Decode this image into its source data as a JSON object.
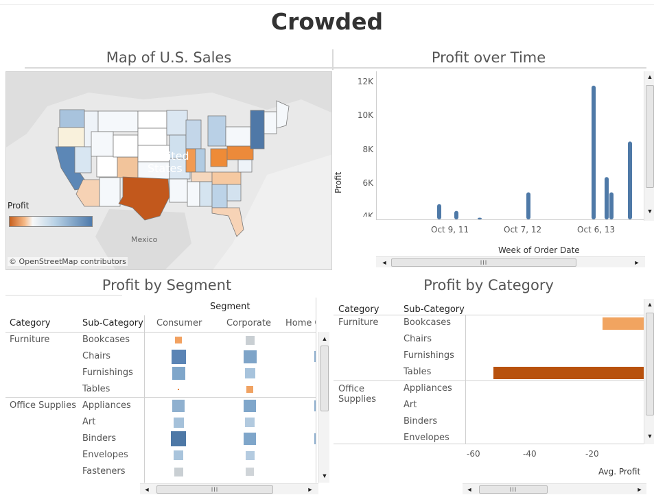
{
  "dashboard": {
    "title": "Crowded"
  },
  "panes": {
    "map": {
      "title": "Map of U.S. Sales"
    },
    "time": {
      "title": "Profit over Time"
    },
    "segment": {
      "title": "Profit by Segment"
    },
    "category": {
      "title": "Profit by Category"
    }
  },
  "map": {
    "country_label": "United\nStates",
    "country_label_line1": "United",
    "country_label_line2": "States",
    "mexico_label": "Mexico",
    "legend_title": "Profit",
    "attribution": "© OpenStreetMap contributors",
    "colors": {
      "negative": "#c8601d",
      "neutral": "#f8f8f8",
      "positive": "#4e7aab",
      "land": "#e5e5e5"
    }
  },
  "chart_data": [
    {
      "type": "bar",
      "title": "Profit over Time",
      "xlabel": "Week of Order Date",
      "ylabel": "Profit",
      "x_ticks": [
        "Oct 9, 11",
        "Oct 7, 12",
        "Oct 6, 13"
      ],
      "y_ticks": [
        "4K",
        "6K",
        "8K",
        "10K",
        "12K"
      ],
      "ylim": [
        4000,
        12500
      ],
      "x": [
        "~Sep 2011",
        "~Oct 2011",
        "~Dec 2011",
        "~Sep 2012",
        "~Sep 2013",
        "~Nov 2013",
        "~Dec 2013",
        "~Feb 2014",
        "~Dec 2014"
      ],
      "values": [
        4900,
        4500,
        4100,
        5600,
        4000,
        11900,
        6500,
        5600,
        8600
      ],
      "series": [
        {
          "values": [
            4900,
            4500,
            4100,
            5600,
            4000,
            11900,
            6500,
            5600,
            8600
          ]
        }
      ],
      "color": "#4e79a7",
      "grid": false
    },
    {
      "type": "heatmap",
      "title": "Profit by Segment",
      "column_header": "Segment",
      "row_headers": [
        "Category",
        "Sub-Category"
      ],
      "columns": [
        "Consumer",
        "Corporate",
        "Home O"
      ],
      "rows": [
        {
          "category": "Furniture",
          "sub": "Bookcases",
          "consumer": {
            "size": 0.45,
            "color": "#f2a160"
          },
          "corporate": {
            "size": 0.6,
            "color": "#c9cfd3"
          }
        },
        {
          "category": "",
          "sub": "Chairs",
          "consumer": {
            "size": 0.95,
            "color": "#5a84b5"
          },
          "corporate": {
            "size": 0.85,
            "color": "#7ea4c8"
          }
        },
        {
          "category": "",
          "sub": "Furnishings",
          "consumer": {
            "size": 0.85,
            "color": "#7fa6ca"
          },
          "corporate": {
            "size": 0.7,
            "color": "#a7c3dc"
          }
        },
        {
          "category": "",
          "sub": "Tables",
          "consumer": {
            "size": 0.1,
            "color": "#e8843d"
          },
          "corporate": {
            "size": 0.45,
            "color": "#f0a262"
          }
        },
        {
          "category": "Office Supplies",
          "sub": "Appliances",
          "consumer": {
            "size": 0.8,
            "color": "#8fb0cf"
          },
          "corporate": {
            "size": 0.8,
            "color": "#7fa6ca"
          }
        },
        {
          "category": "",
          "sub": "Art",
          "consumer": {
            "size": 0.7,
            "color": "#a5c1da"
          },
          "corporate": {
            "size": 0.65,
            "color": "#b2cadf"
          }
        },
        {
          "category": "",
          "sub": "Binders",
          "consumer": {
            "size": 1.0,
            "color": "#4e78a6"
          },
          "corporate": {
            "size": 0.8,
            "color": "#7fa6ca"
          }
        },
        {
          "category": "",
          "sub": "Envelopes",
          "consumer": {
            "size": 0.65,
            "color": "#a9c4dc"
          },
          "corporate": {
            "size": 0.6,
            "color": "#b4cbe0"
          }
        },
        {
          "category": "",
          "sub": "Fasteners",
          "consumer": {
            "size": 0.6,
            "color": "#c9cfd3"
          },
          "corporate": {
            "size": 0.55,
            "color": "#cfd4d8"
          }
        }
      ]
    },
    {
      "type": "bar",
      "title": "Profit by Category",
      "xlabel": "Avg. Profit",
      "row_headers": [
        "Category",
        "Sub-Category"
      ],
      "categories": [
        "Bookcases",
        "Chairs",
        "Furnishings",
        "Tables",
        "Appliances",
        "Art",
        "Binders",
        "Envelopes"
      ],
      "groups": [
        {
          "category": "Furniture",
          "subs": [
            "Bookcases",
            "Chairs",
            "Furnishings",
            "Tables"
          ]
        },
        {
          "category": "Office Supplies",
          "category_line1": "Office",
          "category_line2": "Supplies",
          "subs": [
            "Appliances",
            "Art",
            "Binders",
            "Envelopes"
          ]
        }
      ],
      "values": [
        -15.2,
        null,
        null,
        -55.6,
        null,
        null,
        null,
        null
      ],
      "bar_colors": [
        "#f1a460",
        null,
        null,
        "#b8510d",
        null,
        null,
        null,
        null
      ],
      "x_ticks": [
        "-60",
        "-40",
        "-20"
      ],
      "xlim": [
        -66,
        0
      ]
    }
  ],
  "scrollbars": {
    "thumb_grip": "III",
    "left": "◄",
    "right": "►",
    "up": "▲",
    "down": "▼"
  }
}
